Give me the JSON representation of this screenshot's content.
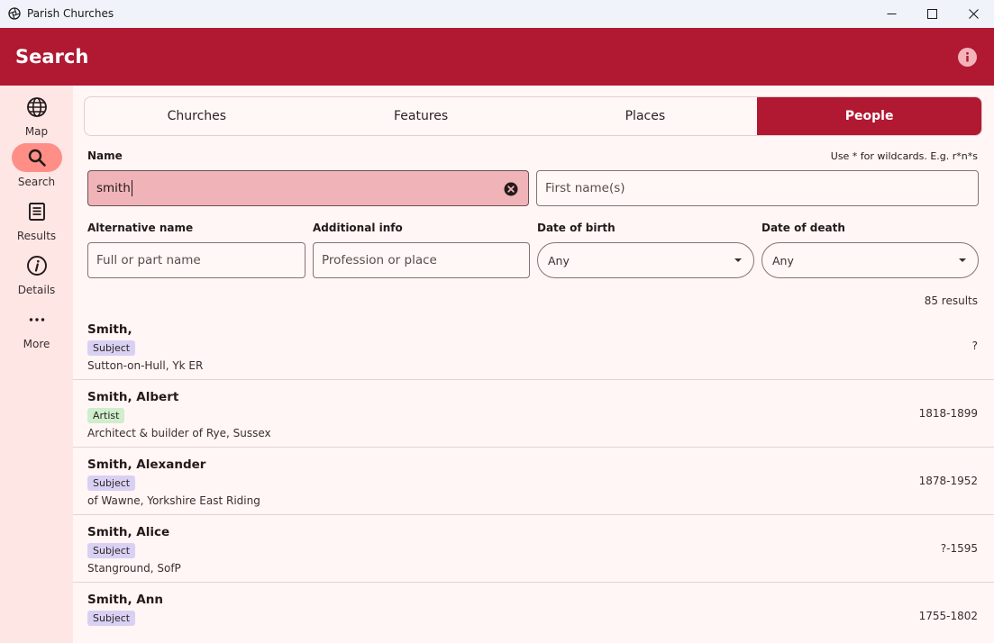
{
  "window": {
    "title": "Parish Churches",
    "icons": {
      "app": "aperture-icon",
      "minimize": "minimize-icon",
      "maximize": "maximize-icon",
      "close": "close-icon"
    }
  },
  "header": {
    "title": "Search",
    "info_icon": "info-icon"
  },
  "nav": {
    "items": [
      {
        "label": "Map",
        "icon": "globe-icon"
      },
      {
        "label": "Search",
        "icon": "search-icon",
        "active": true
      },
      {
        "label": "Results",
        "icon": "list-icon"
      },
      {
        "label": "Details",
        "icon": "info-circle-icon"
      },
      {
        "label": "More",
        "icon": "more-icon"
      }
    ]
  },
  "tabs": [
    {
      "label": "Churches"
    },
    {
      "label": "Features"
    },
    {
      "label": "Places"
    },
    {
      "label": "People",
      "active": true
    }
  ],
  "form": {
    "name_label": "Name",
    "wildcard_hint": "Use * for wildcards. E.g. r*n*s",
    "name_value": "smith",
    "first_name_placeholder": "First name(s)",
    "alt_name_label": "Alternative name",
    "alt_name_placeholder": "Full or part name",
    "additional_label": "Additional info",
    "additional_placeholder": "Profession or place",
    "dob_label": "Date of birth",
    "dob_value": "Any",
    "dod_label": "Date of death",
    "dod_value": "Any"
  },
  "results": {
    "count_text": "85 results",
    "items": [
      {
        "name": "Smith,",
        "role": "Subject",
        "desc": "Sutton-on-Hull, Yk ER",
        "dates": "?"
      },
      {
        "name": "Smith, Albert",
        "role": "Artist",
        "desc": "Architect & builder of Rye, Sussex",
        "dates": "1818-1899"
      },
      {
        "name": "Smith, Alexander",
        "role": "Subject",
        "desc": "of Wawne, Yorkshire East Riding",
        "dates": "1878-1952"
      },
      {
        "name": "Smith, Alice",
        "role": "Subject",
        "desc": "Stanground, SofP",
        "dates": "?-1595"
      },
      {
        "name": "Smith, Ann",
        "role": "Subject",
        "desc": "",
        "dates": "1755-1802"
      }
    ]
  },
  "colors": {
    "accent": "#b11831",
    "rail": "#fee6e5",
    "active_pill": "#ff8e86",
    "subject_badge": "#d9d1f3",
    "artist_badge": "#cfeecb"
  }
}
